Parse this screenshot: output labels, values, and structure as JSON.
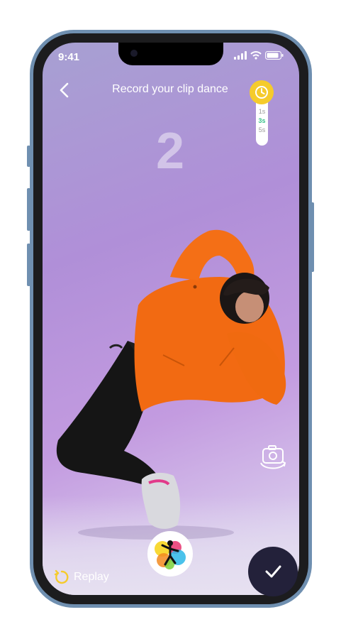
{
  "status": {
    "time": "9:41"
  },
  "header": {
    "title": "Record your clip dance"
  },
  "timer": {
    "options": [
      "1s",
      "3s",
      "5s"
    ],
    "selected": "3s"
  },
  "countdown": {
    "value": "2"
  },
  "controls": {
    "replay_label": "Replay"
  },
  "colors": {
    "timer_accent": "#f5cb2c",
    "active_option": "#38c08a",
    "confirm_bg": "#23213a"
  }
}
